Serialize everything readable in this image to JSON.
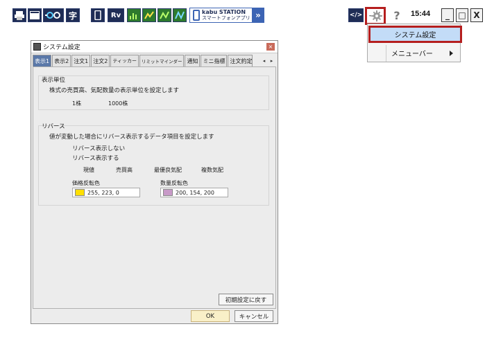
{
  "toolbar": {
    "kana_button": "字",
    "rv_button": "Rv",
    "kabu_line1": "kabu STATION",
    "kabu_line2": "スマートフォンアプリ",
    "kabu_arrow": "»",
    "code_button": "</>",
    "help_button": "?",
    "time": "15:44",
    "minimize": "_",
    "maximize": "□",
    "close": "X"
  },
  "menu": {
    "items": [
      {
        "label": "システム設定"
      },
      {
        "label": "メニューバー"
      }
    ]
  },
  "dialog": {
    "title": "システム設定",
    "close": "×",
    "tabs": [
      {
        "label": "表示1"
      },
      {
        "label": "表示2"
      },
      {
        "label": "注文1"
      },
      {
        "label": "注文2"
      },
      {
        "label": "ティッカー"
      },
      {
        "label": "リミットマインダー"
      },
      {
        "label": "通知"
      },
      {
        "label": "ミニ指標"
      },
      {
        "label": "注文約定"
      }
    ],
    "tab_prev": "◂",
    "tab_next": "▸",
    "unit_section": {
      "title": "表示単位",
      "description": "株式の売買高、気配数量の表示単位を設定します",
      "options": [
        "1株",
        "1000株"
      ]
    },
    "reverse_section": {
      "title": "リバース",
      "description": "値が変動した場合にリバース表示するデータ項目を設定します",
      "off_label": "リバース表示しない",
      "on_label": "リバース表示する",
      "items": [
        "現値",
        "売買高",
        "最優良気配",
        "複数気配"
      ],
      "price_color_label": "価格反転色",
      "price_color_value": "255, 223, 0",
      "price_color": "#ffdf00",
      "qty_color_label": "数量反転色",
      "qty_color_value": "200, 154, 200",
      "qty_color": "#c89ac8"
    },
    "reset_button": "初期設定に戻す",
    "ok_button": "OK",
    "cancel_button": "キャンセル"
  }
}
